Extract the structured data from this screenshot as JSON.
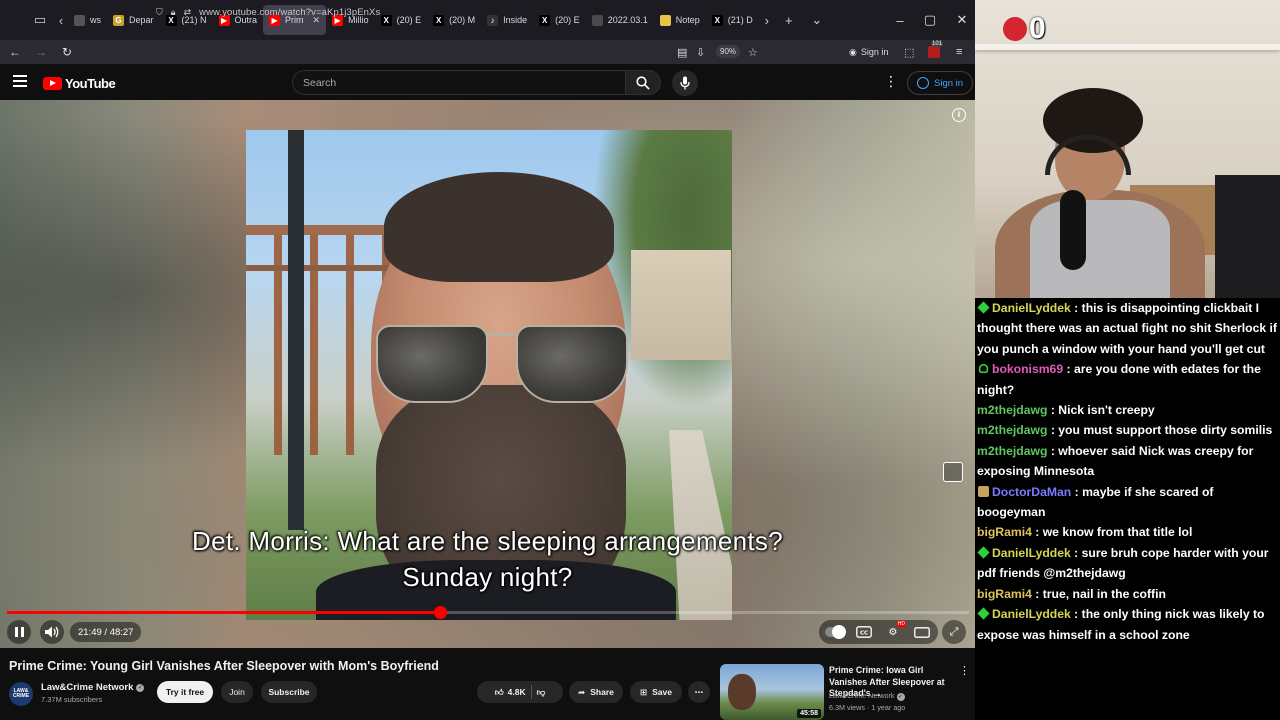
{
  "browser": {
    "tabs": [
      {
        "label": "ws",
        "color": "#555555",
        "glyph": ""
      },
      {
        "label": "Depar",
        "color": "#c9a227",
        "glyph": "G"
      },
      {
        "label": "(21) N",
        "color": "#000000",
        "glyph": "X"
      },
      {
        "label": "Outra",
        "color": "#ff0000",
        "glyph": "▶"
      },
      {
        "label": "Prim",
        "color": "#ff0000",
        "glyph": "▶",
        "active": true
      },
      {
        "label": "Millio",
        "color": "#ff0000",
        "glyph": "▶"
      },
      {
        "label": "(20) E",
        "color": "#000000",
        "glyph": "X"
      },
      {
        "label": "(20) M",
        "color": "#000000",
        "glyph": "X"
      },
      {
        "label": "Inside",
        "color": "#333333",
        "glyph": "♪"
      },
      {
        "label": "(20) E",
        "color": "#000000",
        "glyph": "X"
      },
      {
        "label": "2022.03.1",
        "color": "#4a4a4a",
        "glyph": ""
      },
      {
        "label": "Notep",
        "color": "#e8c34a",
        "glyph": ""
      },
      {
        "label": "(21) D",
        "color": "#000000",
        "glyph": "X"
      }
    ],
    "url": "www.youtube.com/watch?v=aKp1j3pEnXs",
    "zoom": "90%",
    "signin_label": "Sign in",
    "extension_badge": "101"
  },
  "youtube": {
    "logo_text": "YouTube",
    "search_placeholder": "Search",
    "signin_label": "Sign in"
  },
  "player": {
    "subtitle_line1": "Det. Morris: What are the sleeping arrangements?",
    "subtitle_line2": "Sunday night?",
    "time_current": "21:49",
    "time_total": "48:27",
    "time_display": "21:49 / 48:27",
    "progress_fraction": 0.45
  },
  "video": {
    "title": "Prime Crime: Young Girl Vanishes After Sleepover with Mom's Boyfriend",
    "channel": "Law&Crime Network",
    "channel_avatar_text": "LAW& CRIME",
    "subscribers": "7.37M subscribers",
    "try_label": "Try it free",
    "join_label": "Join",
    "subscribe_label": "Subscribe",
    "likes": "4.8K",
    "share_label": "Share",
    "save_label": "Save"
  },
  "recommended": {
    "title": "Prime Crime: Iowa Girl Vanishes After Sleepover at Stepdad's ...",
    "channel": "Law&Crime Network",
    "meta": "6.3M views · 1 year ago",
    "duration": "45:58"
  },
  "stream": {
    "counter": "0",
    "counter_color": "#d3262f"
  },
  "chat": [
    {
      "badge": "diamond",
      "user": "DanielLyddek",
      "color": "#d7d552",
      "text": "this is disappointing clickbait I thought there was an actual fight no shit Sherlock if you punch a window with your hand you'll get cut"
    },
    {
      "badge": "person",
      "user": "bokonism69",
      "color": "#e05cb8",
      "text": "are you done with edates for the night?"
    },
    {
      "badge": "",
      "user": "m2thejdawg",
      "color": "#5fc660",
      "text": "Nick isn't creepy"
    },
    {
      "badge": "",
      "user": "m2thejdawg",
      "color": "#5fc660",
      "text": "you must support those dirty somilis"
    },
    {
      "badge": "",
      "user": "m2thejdawg",
      "color": "#5fc660",
      "text": "whoever said Nick was creepy for exposing Minnesota"
    },
    {
      "badge": "emote",
      "user": "DoctorDaMan",
      "color": "#7a7cff",
      "text": "maybe if she scared of boogeyman"
    },
    {
      "badge": "",
      "user": "bigRami4",
      "color": "#e0c25a",
      "text": "we know from that title lol"
    },
    {
      "badge": "diamond",
      "user": "DanielLyddek",
      "color": "#d7d552",
      "text": "sure bruh cope harder with your pdf friends @m2thejdawg"
    },
    {
      "badge": "",
      "user": "bigRami4",
      "color": "#e0c25a",
      "text": "true, nail in the coffin"
    },
    {
      "badge": "diamond",
      "user": "DanielLyddek",
      "color": "#d7d552",
      "text": "the only thing nick was likely to expose was himself in a school zone"
    }
  ]
}
